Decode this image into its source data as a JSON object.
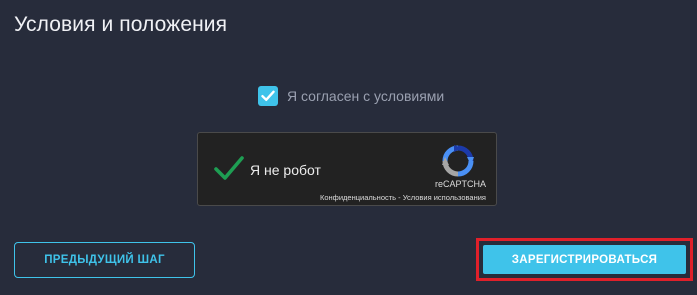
{
  "section": {
    "title": "Условия и положения"
  },
  "agreement": {
    "label": "Я согласен с условиями",
    "checked": true,
    "check_color": "#3fc3ea"
  },
  "recaptcha": {
    "label": "Я не робот",
    "verified": true,
    "brand": "reCAPTCHA",
    "privacy_link": "Конфиденциальность",
    "separator": " - ",
    "terms_link": "Условия использования",
    "check_color": "#1e9e53"
  },
  "buttons": {
    "previous": "ПРЕДЫДУЩИЙ ШАГ",
    "register": "ЗАРЕГИСТРИРОВАТЬСЯ"
  },
  "colors": {
    "background": "#272c3b",
    "accent": "#3fc3ea",
    "highlight": "#e0202a"
  }
}
